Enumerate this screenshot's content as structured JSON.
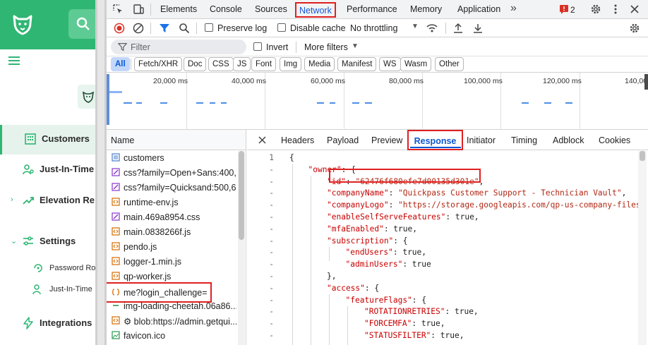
{
  "app": {
    "nav": [
      {
        "label": "Customers",
        "icon": "building-icon"
      },
      {
        "label": "Just-In-Time A",
        "icon": "user-key-icon"
      },
      {
        "label": "Elevation Re",
        "icon": "chart-up-icon"
      },
      {
        "label": "Settings",
        "icon": "sliders-icon"
      },
      {
        "label": "Password Ro",
        "icon": "rotate-key-icon"
      },
      {
        "label": "Just-In-Time",
        "icon": "user-key-icon"
      },
      {
        "label": "Integrations",
        "icon": "bolt-icon"
      }
    ],
    "brand_color": "#2fb673"
  },
  "devtools": {
    "tabs": [
      "Elements",
      "Console",
      "Sources",
      "Network",
      "Performance",
      "Memory",
      "Application"
    ],
    "more_tabs": "»",
    "issues_count": "2",
    "toolbar": {
      "preserve_log": "Preserve log",
      "disable_cache": "Disable cache",
      "throttling": "No throttling"
    },
    "filter": {
      "placeholder": "Filter",
      "invert": "Invert",
      "more_filters": "More filters"
    },
    "types": [
      "All",
      "Fetch/XHR",
      "Doc",
      "CSS",
      "JS",
      "Font",
      "Img",
      "Media",
      "Manifest",
      "WS",
      "Wasm",
      "Other"
    ],
    "timeline_ticks": [
      "20,000 ms",
      "40,000 ms",
      "60,000 ms",
      "80,000 ms",
      "100,000 ms",
      "120,000 ms",
      "140,00"
    ],
    "requests_header": "Name",
    "requests": [
      {
        "name": "customers",
        "icon": "document-icon"
      },
      {
        "name": "css?family=Open+Sans:400,...",
        "icon": "stylesheet-icon"
      },
      {
        "name": "css?family=Quicksand:500,6...",
        "icon": "stylesheet-icon"
      },
      {
        "name": "runtime-env.js",
        "icon": "script-icon"
      },
      {
        "name": "main.469a8954.css",
        "icon": "stylesheet-icon"
      },
      {
        "name": "main.0838266f.js",
        "icon": "script-icon"
      },
      {
        "name": "pendo.js",
        "icon": "script-icon"
      },
      {
        "name": "logger-1.min.js",
        "icon": "script-icon"
      },
      {
        "name": "qp-worker.js",
        "icon": "script-icon"
      },
      {
        "name": "me?login_challenge=",
        "icon": "fetch-icon"
      },
      {
        "name": "img-loading-cheetah.06a86...",
        "icon": "image-icon"
      },
      {
        "name": "⚙ blob:https://admin.getqui...",
        "icon": "script-icon"
      },
      {
        "name": "favicon.ico",
        "icon": "image-icon"
      }
    ],
    "panel_tabs": [
      "Headers",
      "Payload",
      "Preview",
      "Response",
      "Initiator",
      "Timing",
      "Adblock",
      "Cookies"
    ],
    "response_lines": [
      {
        "num": "1",
        "indent": 0,
        "key": "",
        "value": "{"
      },
      {
        "num": "-",
        "indent": 1,
        "key": "\"owner\"",
        "value": ": {"
      },
      {
        "num": "-",
        "indent": 2,
        "key": "\"id\"",
        "value": ": ",
        "str": "\"62476f680efe7d00135d301e\"",
        "tail": ","
      },
      {
        "num": "-",
        "indent": 2,
        "key": "\"companyName\"",
        "value": ": ",
        "str": "\"Quickpass Customer Support - Technician Vault\"",
        "tail": ","
      },
      {
        "num": "-",
        "indent": 2,
        "key": "\"companyLogo\"",
        "value": ": ",
        "str": "\"https://storage.googleapis.com/qp-us-company-files",
        "tail": ""
      },
      {
        "num": "-",
        "indent": 2,
        "key": "\"enableSelfServeFeatures\"",
        "value": ": true,"
      },
      {
        "num": "-",
        "indent": 2,
        "key": "\"mfaEnabled\"",
        "value": ": true,"
      },
      {
        "num": "-",
        "indent": 2,
        "key": "\"subscription\"",
        "value": ": {"
      },
      {
        "num": "-",
        "indent": 3,
        "key": "\"endUsers\"",
        "value": ": true,"
      },
      {
        "num": "-",
        "indent": 3,
        "key": "\"adminUsers\"",
        "value": ": true"
      },
      {
        "num": "-",
        "indent": 2,
        "key": "",
        "value": "},"
      },
      {
        "num": "-",
        "indent": 2,
        "key": "\"access\"",
        "value": ": {"
      },
      {
        "num": "-",
        "indent": 3,
        "key": "\"featureFlags\"",
        "value": ": {"
      },
      {
        "num": "-",
        "indent": 4,
        "key": "\"ROTATIONRETRIES\"",
        "value": ": true,"
      },
      {
        "num": "-",
        "indent": 4,
        "key": "\"FORCEMFA\"",
        "value": ": true,"
      },
      {
        "num": "-",
        "indent": 4,
        "key": "\"STATUSFILTER\"",
        "value": ": true,"
      }
    ]
  }
}
